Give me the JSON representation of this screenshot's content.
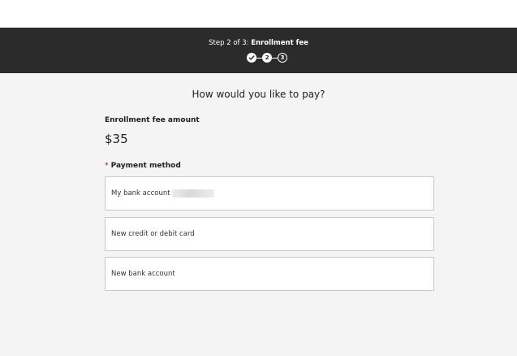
{
  "stepper": {
    "prefix": "Step 2 of 3:",
    "current_step_name": "Enrollment fee",
    "steps": [
      {
        "label": "",
        "state": "complete",
        "icon": "check-icon"
      },
      {
        "label": "2",
        "state": "current"
      },
      {
        "label": "3",
        "state": "upcoming"
      }
    ]
  },
  "main": {
    "title": "How would you like to pay?",
    "fee_label": "Enrollment fee amount",
    "fee_amount": "$35",
    "payment_method_required_marker": "*",
    "payment_method_label": "Payment method",
    "options": [
      {
        "label": "My bank account"
      },
      {
        "label": "New credit or debit card"
      },
      {
        "label": "New bank account"
      }
    ]
  },
  "colors": {
    "header_bg": "#2b2b2b",
    "page_bg": "#f4f4f4",
    "required_star": "#d0021b"
  }
}
